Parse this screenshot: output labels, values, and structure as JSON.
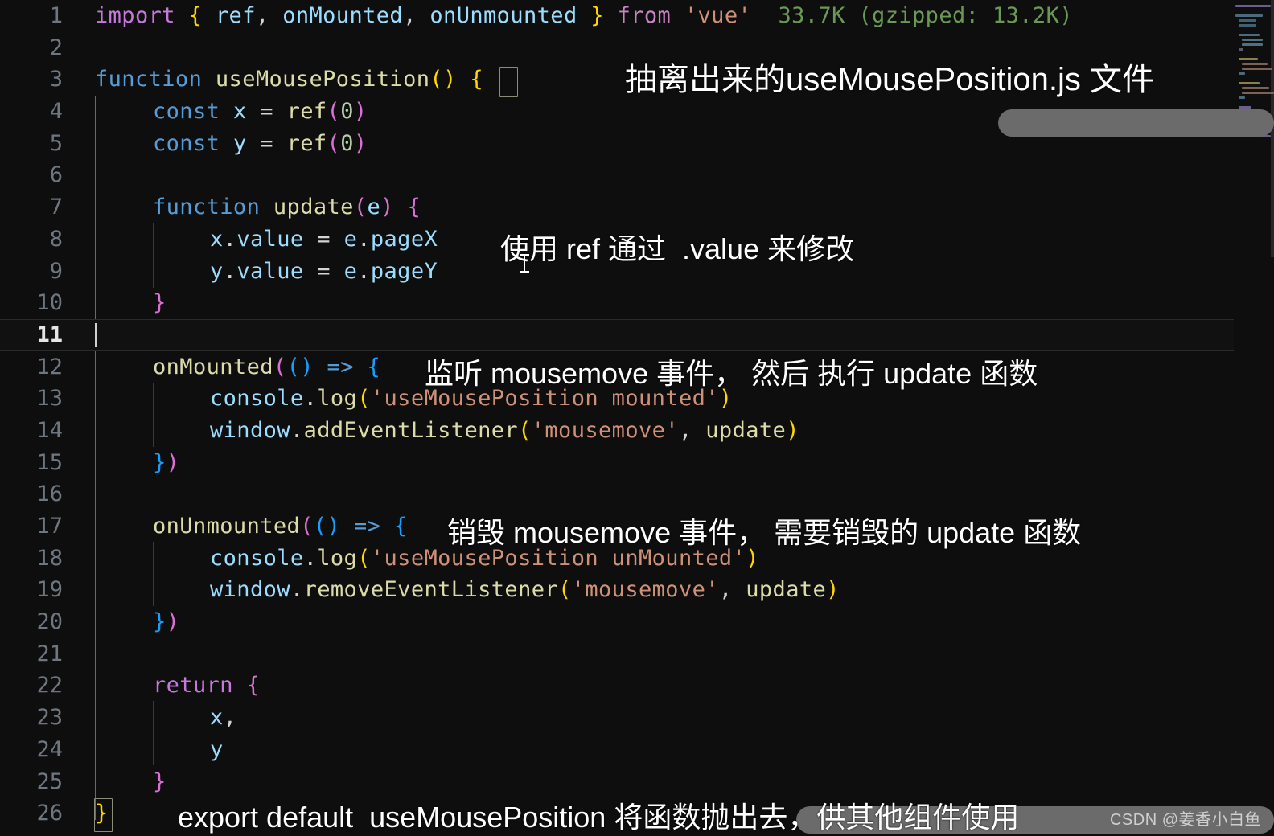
{
  "editor": {
    "language": "javascript",
    "active_line": 11,
    "total_lines": 26,
    "import_cost_hint": "33.7K (gzipped: 13.2K)",
    "gutter_numbers": [
      "1",
      "2",
      "3",
      "4",
      "5",
      "6",
      "7",
      "8",
      "9",
      "10",
      "11",
      "12",
      "13",
      "14",
      "15",
      "16",
      "17",
      "18",
      "19",
      "20",
      "21",
      "22",
      "23",
      "24",
      "25",
      "26"
    ],
    "lines": [
      {
        "n": "1",
        "text": "import { ref, onMounted, onUnmounted } from 'vue'"
      },
      {
        "n": "2",
        "text": ""
      },
      {
        "n": "3",
        "text": "function useMousePosition() {"
      },
      {
        "n": "4",
        "text": "    const x = ref(0)"
      },
      {
        "n": "5",
        "text": "    const y = ref(0)"
      },
      {
        "n": "6",
        "text": ""
      },
      {
        "n": "7",
        "text": "    function update(e) {"
      },
      {
        "n": "8",
        "text": "        x.value = e.pageX"
      },
      {
        "n": "9",
        "text": "        y.value = e.pageY"
      },
      {
        "n": "10",
        "text": "    }"
      },
      {
        "n": "11",
        "text": ""
      },
      {
        "n": "12",
        "text": "    onMounted(() => {"
      },
      {
        "n": "13",
        "text": "        console.log('useMousePosition mounted')"
      },
      {
        "n": "14",
        "text": "        window.addEventListener('mousemove', update)"
      },
      {
        "n": "15",
        "text": "    })"
      },
      {
        "n": "16",
        "text": ""
      },
      {
        "n": "17",
        "text": "    onUnmounted(() => {"
      },
      {
        "n": "18",
        "text": "        console.log('useMousePosition unMounted')"
      },
      {
        "n": "19",
        "text": "        window.removeEventListener('mousemove', update)"
      },
      {
        "n": "20",
        "text": "    })"
      },
      {
        "n": "21",
        "text": ""
      },
      {
        "n": "22",
        "text": "    return {"
      },
      {
        "n": "23",
        "text": "        x,"
      },
      {
        "n": "24",
        "text": "        y"
      },
      {
        "n": "25",
        "text": "    }"
      },
      {
        "n": "26",
        "text": "}"
      }
    ]
  },
  "tokens": {
    "import": "import",
    "from": "from",
    "vue": "'vue'",
    "ref": "ref",
    "onMounted": "onMounted",
    "onUnmounted": "onUnmounted",
    "function": "function",
    "useMousePosition": "useMousePosition",
    "const": "const",
    "update": "update",
    "console": "console",
    "log": "log",
    "window": "window",
    "addEventListener": "addEventListener",
    "removeEventListener": "removeEventListener",
    "return": "return",
    "x": "x",
    "y": "y",
    "e": "e",
    "value": "value",
    "pageX": "pageX",
    "pageY": "pageY",
    "zero": "0",
    "str_mounted": "'useMousePosition mounted'",
    "str_unmounted": "'useMousePosition unMounted'",
    "str_mousemove": "'mousemove'"
  },
  "annotations": {
    "title": "抽离出来的useMousePosition.js 文件",
    "ref_value": "使用 ref 通过  .value 来修改",
    "on_mounted": "监听 mousemove 事件， 然后 执行 update 函数",
    "on_unmounted": "销毁 mousemove 事件， 需要销毁的 update 函数",
    "export_default": "export default  useMousePosition 将函数抛出去，供其他组件使用"
  },
  "watermark": {
    "text": "CSDN @姜香小白鱼"
  },
  "colors": {
    "background": "#0e0e0e",
    "gutter_text": "#6e7681",
    "active_gutter_text": "#e6e6e6",
    "keyword": "#c678dd",
    "identifier": "#9cdcfe",
    "function_name": "#dcdcaa",
    "string": "#ce9178",
    "number": "#b5cea8",
    "bracket_l1": "#ffd700",
    "bracket_l2": "#da70d6",
    "bracket_l3": "#179fff",
    "import_cost": "#6a9955",
    "annotation": "#ffffff",
    "gray_bar": "#6b6b6b",
    "indent_guide": "#3a3a3a",
    "active_indent_guide": "#7a6a3a"
  }
}
